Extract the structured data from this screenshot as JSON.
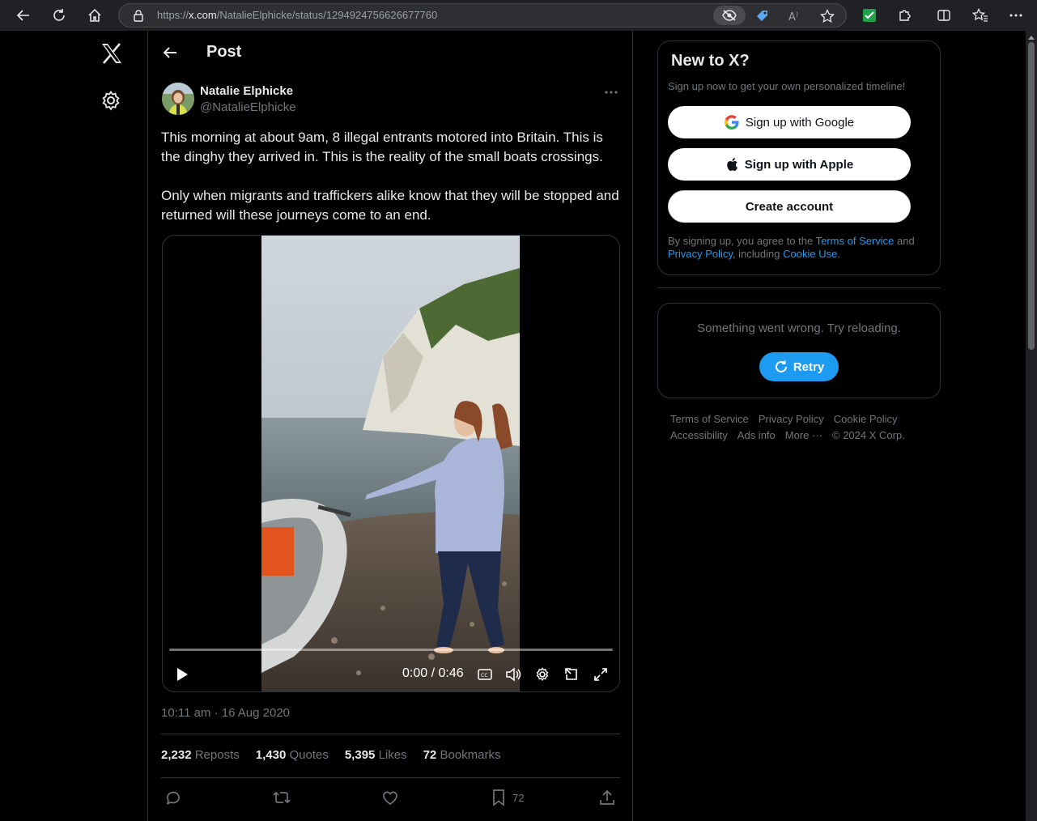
{
  "browser": {
    "url_prefix": "https://",
    "url_domain": "x.com",
    "url_path": "/NatalieElphicke/status/1294924756626677760"
  },
  "header": {
    "title": "Post"
  },
  "post": {
    "author_name": "Natalie Elphicke",
    "author_handle": "@NatalieElphicke",
    "paragraph1": "This morning at about 9am, 8 illegal entrants motored into Britain. This is the dinghy they arrived in. This is the reality of the small boats crossings.",
    "paragraph2": "Only when migrants and traffickers alike know that they will be stopped and returned will these journeys come to an end.",
    "video_time": "0:00 / 0:46",
    "timestamp": "10:11 am · 16 Aug 2020",
    "stats": {
      "reposts_count": "2,232",
      "reposts_label": "Reposts",
      "quotes_count": "1,430",
      "quotes_label": "Quotes",
      "likes_count": "5,395",
      "likes_label": "Likes",
      "bookmarks_count": "72",
      "bookmarks_label": "Bookmarks"
    },
    "bookmark_action_count": "72"
  },
  "sidebar": {
    "signup_title": "New to X?",
    "signup_subtitle": "Sign up now to get your own personalized timeline!",
    "google_label": "Sign up with Google",
    "apple_label": "Sign up with Apple",
    "create_label": "Create account",
    "legal_prefix": "By signing up, you agree to the ",
    "legal_terms": "Terms of Service",
    "legal_and": " and ",
    "legal_privacy": "Privacy Policy",
    "legal_including": ", including ",
    "legal_cookie": "Cookie Use",
    "legal_end": ".",
    "error_text": "Something went wrong. Try reloading.",
    "retry_label": "Retry"
  },
  "footer": {
    "terms": "Terms of Service",
    "privacy": "Privacy Policy",
    "cookie": "Cookie Policy",
    "accessibility": "Accessibility",
    "ads": "Ads info",
    "more": "More ···",
    "copyright": "© 2024 X Corp."
  },
  "colors": {
    "accent": "#1d9bf0",
    "background": "#000000",
    "muted": "#71767b",
    "text": "#e7e9ea"
  }
}
